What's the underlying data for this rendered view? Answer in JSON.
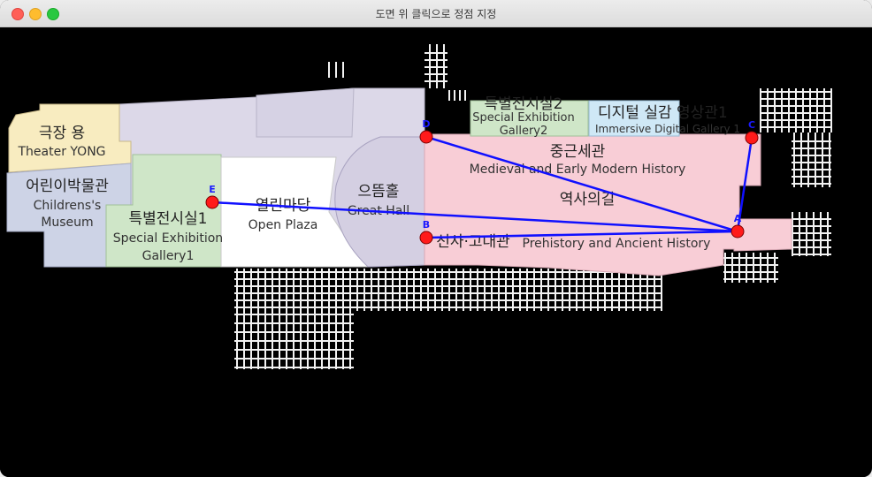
{
  "window": {
    "title": "도면 위 클릭으로 정점 지정"
  },
  "colors": {
    "background": "#000000",
    "hall": "#dcd8e8",
    "theater": "#f8ecc0",
    "children": "#cdd3e6",
    "gallery": "#cfe6c8",
    "plaza": "#ffffff",
    "history": "#f8cdd6",
    "digital": "#cfe8f6",
    "path": "#1010ff",
    "vertex_fill": "#ff1a1a",
    "vertex_label": "#1a1aff"
  },
  "map": {
    "theater": {
      "ko": "극장 용",
      "en": "Theater YONG"
    },
    "children": {
      "ko": "어린이박물관",
      "en1": "Childrens's",
      "en2": "Museum"
    },
    "gallery1": {
      "ko": "특별전시실1",
      "en1": "Special Exhibition",
      "en2": "Gallery1"
    },
    "plaza": {
      "ko": "열린마당",
      "en": "Open Plaza"
    },
    "great_hall": {
      "ko": "으뜸홀",
      "en": "Great Hall"
    },
    "gallery2": {
      "ko": "특별전시실2",
      "en1": "Special Exhibition",
      "en2": "Gallery2"
    },
    "digital": {
      "ko": "디지털 실감 영상관1",
      "en": "Immersive Digital Gallery 1"
    },
    "medieval": {
      "ko": "중근세관",
      "en": "Medieval and Early Modern History"
    },
    "history_road": {
      "ko": "역사의길"
    },
    "prehistory": {
      "ko": "선사·고대관",
      "en": "Prehistory and Ancient History"
    }
  },
  "vertices": [
    {
      "label": "E"
    },
    {
      "label": "D"
    },
    {
      "label": "B"
    },
    {
      "label": "A"
    },
    {
      "label": "C"
    }
  ]
}
